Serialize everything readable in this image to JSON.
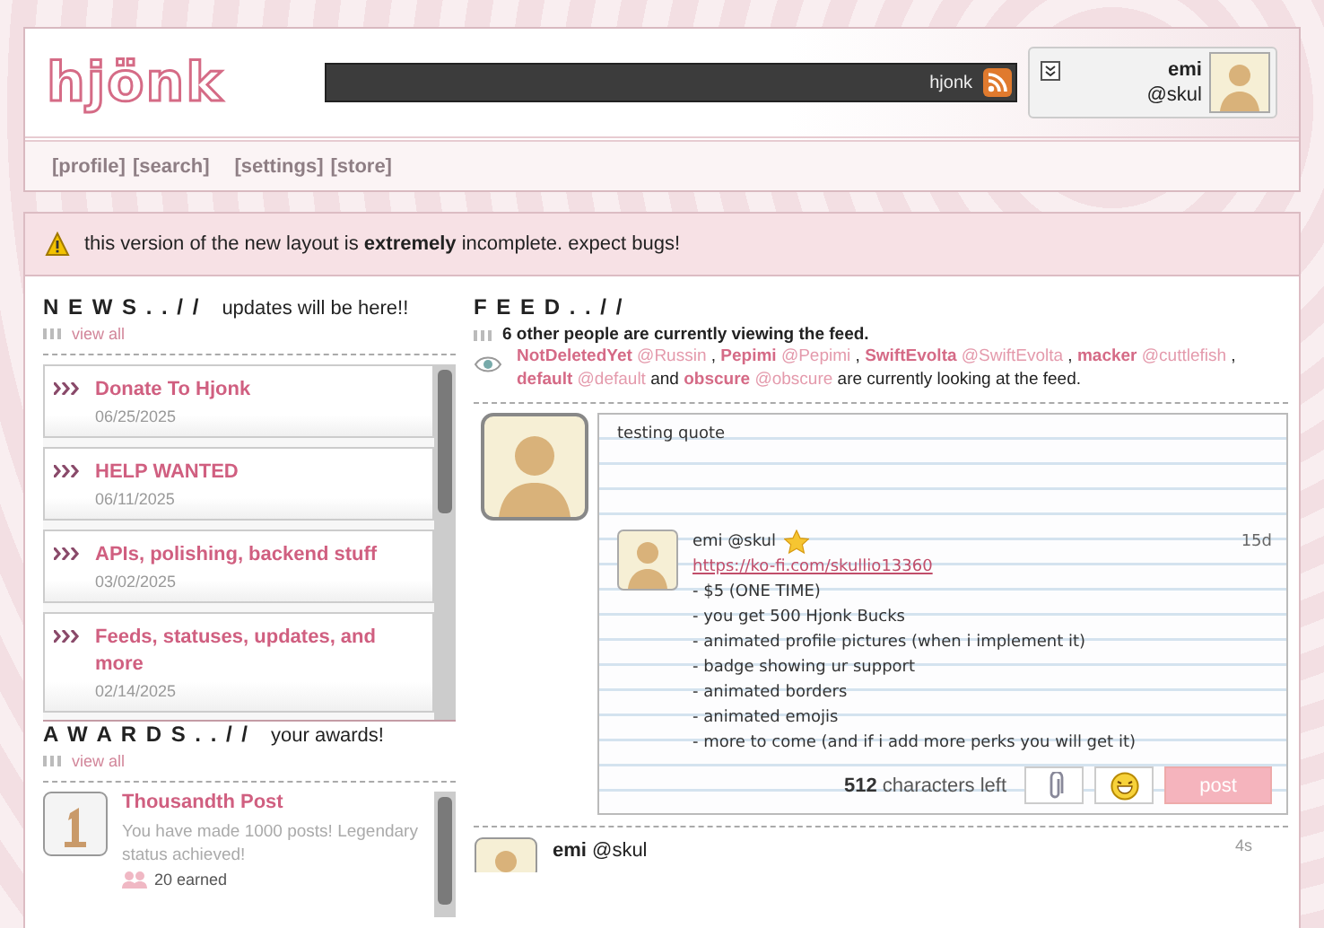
{
  "header": {
    "logo": "hjönk",
    "ticker": "hjonk",
    "user": {
      "name": "emi",
      "handle": "@skul"
    }
  },
  "nav": [
    "[profile]",
    "[search]",
    "[settings]",
    "[store]"
  ],
  "alert": "this version of the new layout is **extremely** incomplete. expect bugs!",
  "news": {
    "title": "N E W S . . / /",
    "subtitle": "updates will be here!!",
    "view_all": "view all",
    "items": [
      {
        "title": "Donate To Hjonk",
        "date": "06/25/2025"
      },
      {
        "title": "HELP WANTED",
        "date": "06/11/2025"
      },
      {
        "title": "APIs, polishing, backend stuff",
        "date": "03/02/2025"
      },
      {
        "title": "Feeds, statuses, updates, and more",
        "date": "02/14/2025"
      }
    ]
  },
  "awards": {
    "title": "A W A R D S . . / /",
    "subtitle": "your awards!",
    "view_all": "view all",
    "items": [
      {
        "title": "Thousandth Post",
        "description": "You have made 1000 posts! Legendary status achieved!",
        "earned": "20 earned"
      }
    ]
  },
  "feed": {
    "title": "F E E D . . / /",
    "viewer_count": "6 other people are currently viewing the feed.",
    "viewers": [
      {
        "name": "NotDeletedYet",
        "handle": "@Russin"
      },
      {
        "name": "Pepimi",
        "handle": "@Pepimi"
      },
      {
        "name": "SwiftEvolta",
        "handle": "@SwiftEvolta"
      },
      {
        "name": "macker",
        "handle": "@cuttlefish"
      },
      {
        "name": "default",
        "handle": "@default"
      },
      {
        "name": "obscure",
        "handle": "@obscure"
      }
    ],
    "separator": ",",
    "conjunction": "and",
    "viewers_tail": "are currently looking at the feed.",
    "composer": {
      "text": "testing quote",
      "quote": {
        "name": "emi",
        "handle": "@skul",
        "time": "15d",
        "link": "https://ko-fi.com/skullio13360",
        "lines": [
          "- $5 (ONE TIME)",
          "- you get 500 Hjonk Bucks",
          "- animated profile pictures (when i implement it)",
          "- badge showing ur support",
          "- animated borders",
          "- animated emojis",
          "- more to come (and if i add more perks you will get it)"
        ]
      },
      "count": "512",
      "count_label": "characters left",
      "post": "post"
    },
    "posts": [
      {
        "name": "emi",
        "handle": "@skul",
        "time": "4s"
      }
    ]
  }
}
